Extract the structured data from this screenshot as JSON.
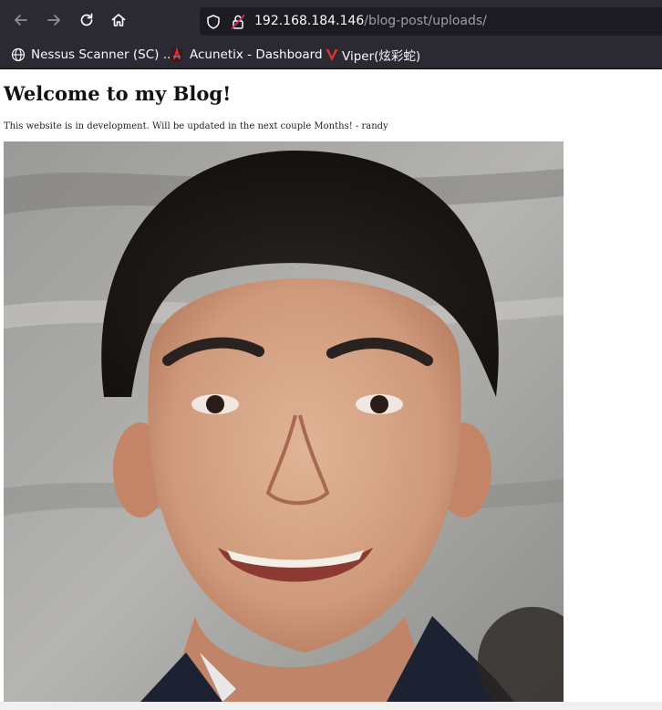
{
  "browser": {
    "url_host": "192.168.184.146",
    "url_path": "/blog-post/uploads/",
    "bookmarks": [
      {
        "label": "Nessus Scanner (SC) ...",
        "icon": "globe-icon"
      },
      {
        "label": "Acunetix - Dashboard",
        "icon": "acunetix-icon"
      },
      {
        "label": "Viper(炫彩蛇)",
        "icon": "viper-icon"
      }
    ]
  },
  "page": {
    "heading": "Welcome to my Blog!",
    "note": "This website is in development. Will be updated in the next couple Months! - randy",
    "image": "portrait photo of smiling man"
  }
}
